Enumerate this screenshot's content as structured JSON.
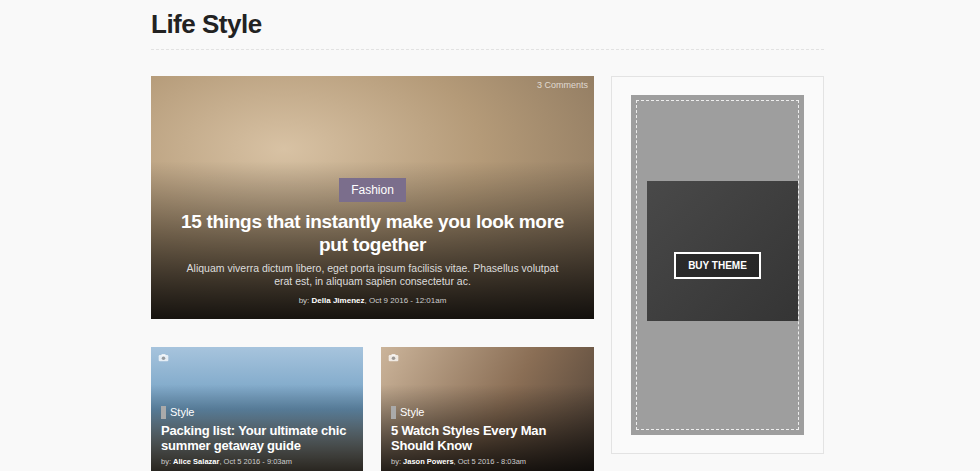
{
  "section": {
    "title": "Life Style"
  },
  "featured": {
    "comments": "3 Comments",
    "category": "Fashion",
    "title": "15 things that instantly make you look more put together",
    "excerpt": "Aliquam viverra dictum libero, eget porta ipsum facilisis vitae. Phasellus volutpat erat est, in aliquam sapien consectetur ac.",
    "by": "by:",
    "author": "Della Jimenez",
    "separator": ",",
    "date": "Oct 9 2016 - 12:01am"
  },
  "posts": [
    {
      "category": "Style",
      "title": "Packing list: Your ultimate chic summer getaway guide",
      "by": "by:",
      "author": "Alice Salazar",
      "separator": ",",
      "date": "Oct 5 2016 - 9:03am"
    },
    {
      "category": "Style",
      "title": "5 Watch Styles Every Man Should Know",
      "by": "by:",
      "author": "Jason Powers",
      "separator": ",",
      "date": "Oct 5 2016 - 8:03am"
    }
  ],
  "ad": {
    "button": "BUY THEME"
  }
}
